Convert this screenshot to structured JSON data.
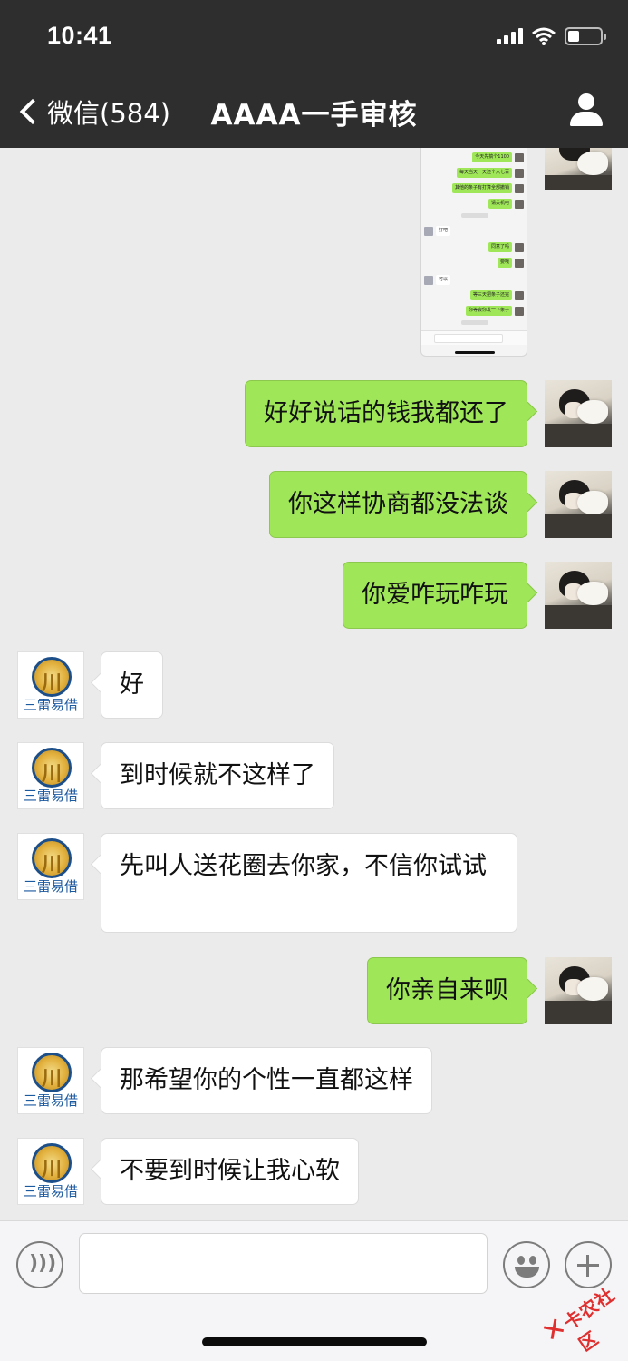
{
  "status_bar": {
    "time": "10:41",
    "battery_level": 0.35
  },
  "nav": {
    "back_label": "微信(584)",
    "title": "AAAA一手审核"
  },
  "screenshot_preview": {
    "rows": [
      {
        "side": "right",
        "text": "今天先搞个1100"
      },
      {
        "side": "right",
        "text": "每天当天一天还个六七百"
      },
      {
        "side": "right",
        "text": "其他的条子有打算全部撤销"
      },
      {
        "side": "right",
        "text": "请关机吧"
      },
      {
        "side": "left",
        "text": "好吧"
      },
      {
        "side": "right",
        "text": "同意了吗"
      },
      {
        "side": "right",
        "text": "要哦"
      },
      {
        "side": "left",
        "text": "可以"
      },
      {
        "side": "right",
        "text": "等三天把条子还完"
      },
      {
        "side": "right",
        "text": "你等会你发一下条子"
      }
    ]
  },
  "messages": [
    {
      "side": "me",
      "text": "好好说话的钱我都还了"
    },
    {
      "side": "me",
      "text": "你这样协商都没法谈"
    },
    {
      "side": "me",
      "text": "你爱咋玩咋玩"
    },
    {
      "side": "them",
      "text": "好"
    },
    {
      "side": "them",
      "text": "到时候就不这样了"
    },
    {
      "side": "them",
      "text": "先叫人送花圈去你家，不信你试试"
    },
    {
      "side": "me",
      "text": "你亲自来呗"
    },
    {
      "side": "them",
      "text": "那希望你的个性一直都这样"
    },
    {
      "side": "them",
      "text": "不要到时候让我心软"
    }
  ],
  "contact_avatar": {
    "logo_text": "三雷易借",
    "colors": {
      "ring": "#1c4f8a",
      "gold": "#e2b13e",
      "text": "#1c5aa0"
    }
  },
  "input": {
    "value": "",
    "placeholder": ""
  },
  "watermark": {
    "text": "卡农社区",
    "mark": "✕"
  },
  "colors": {
    "header_bg": "#2e2e2e",
    "chat_bg": "#ebebeb",
    "my_bubble": "#9fe658",
    "their_bubble": "#ffffff"
  }
}
